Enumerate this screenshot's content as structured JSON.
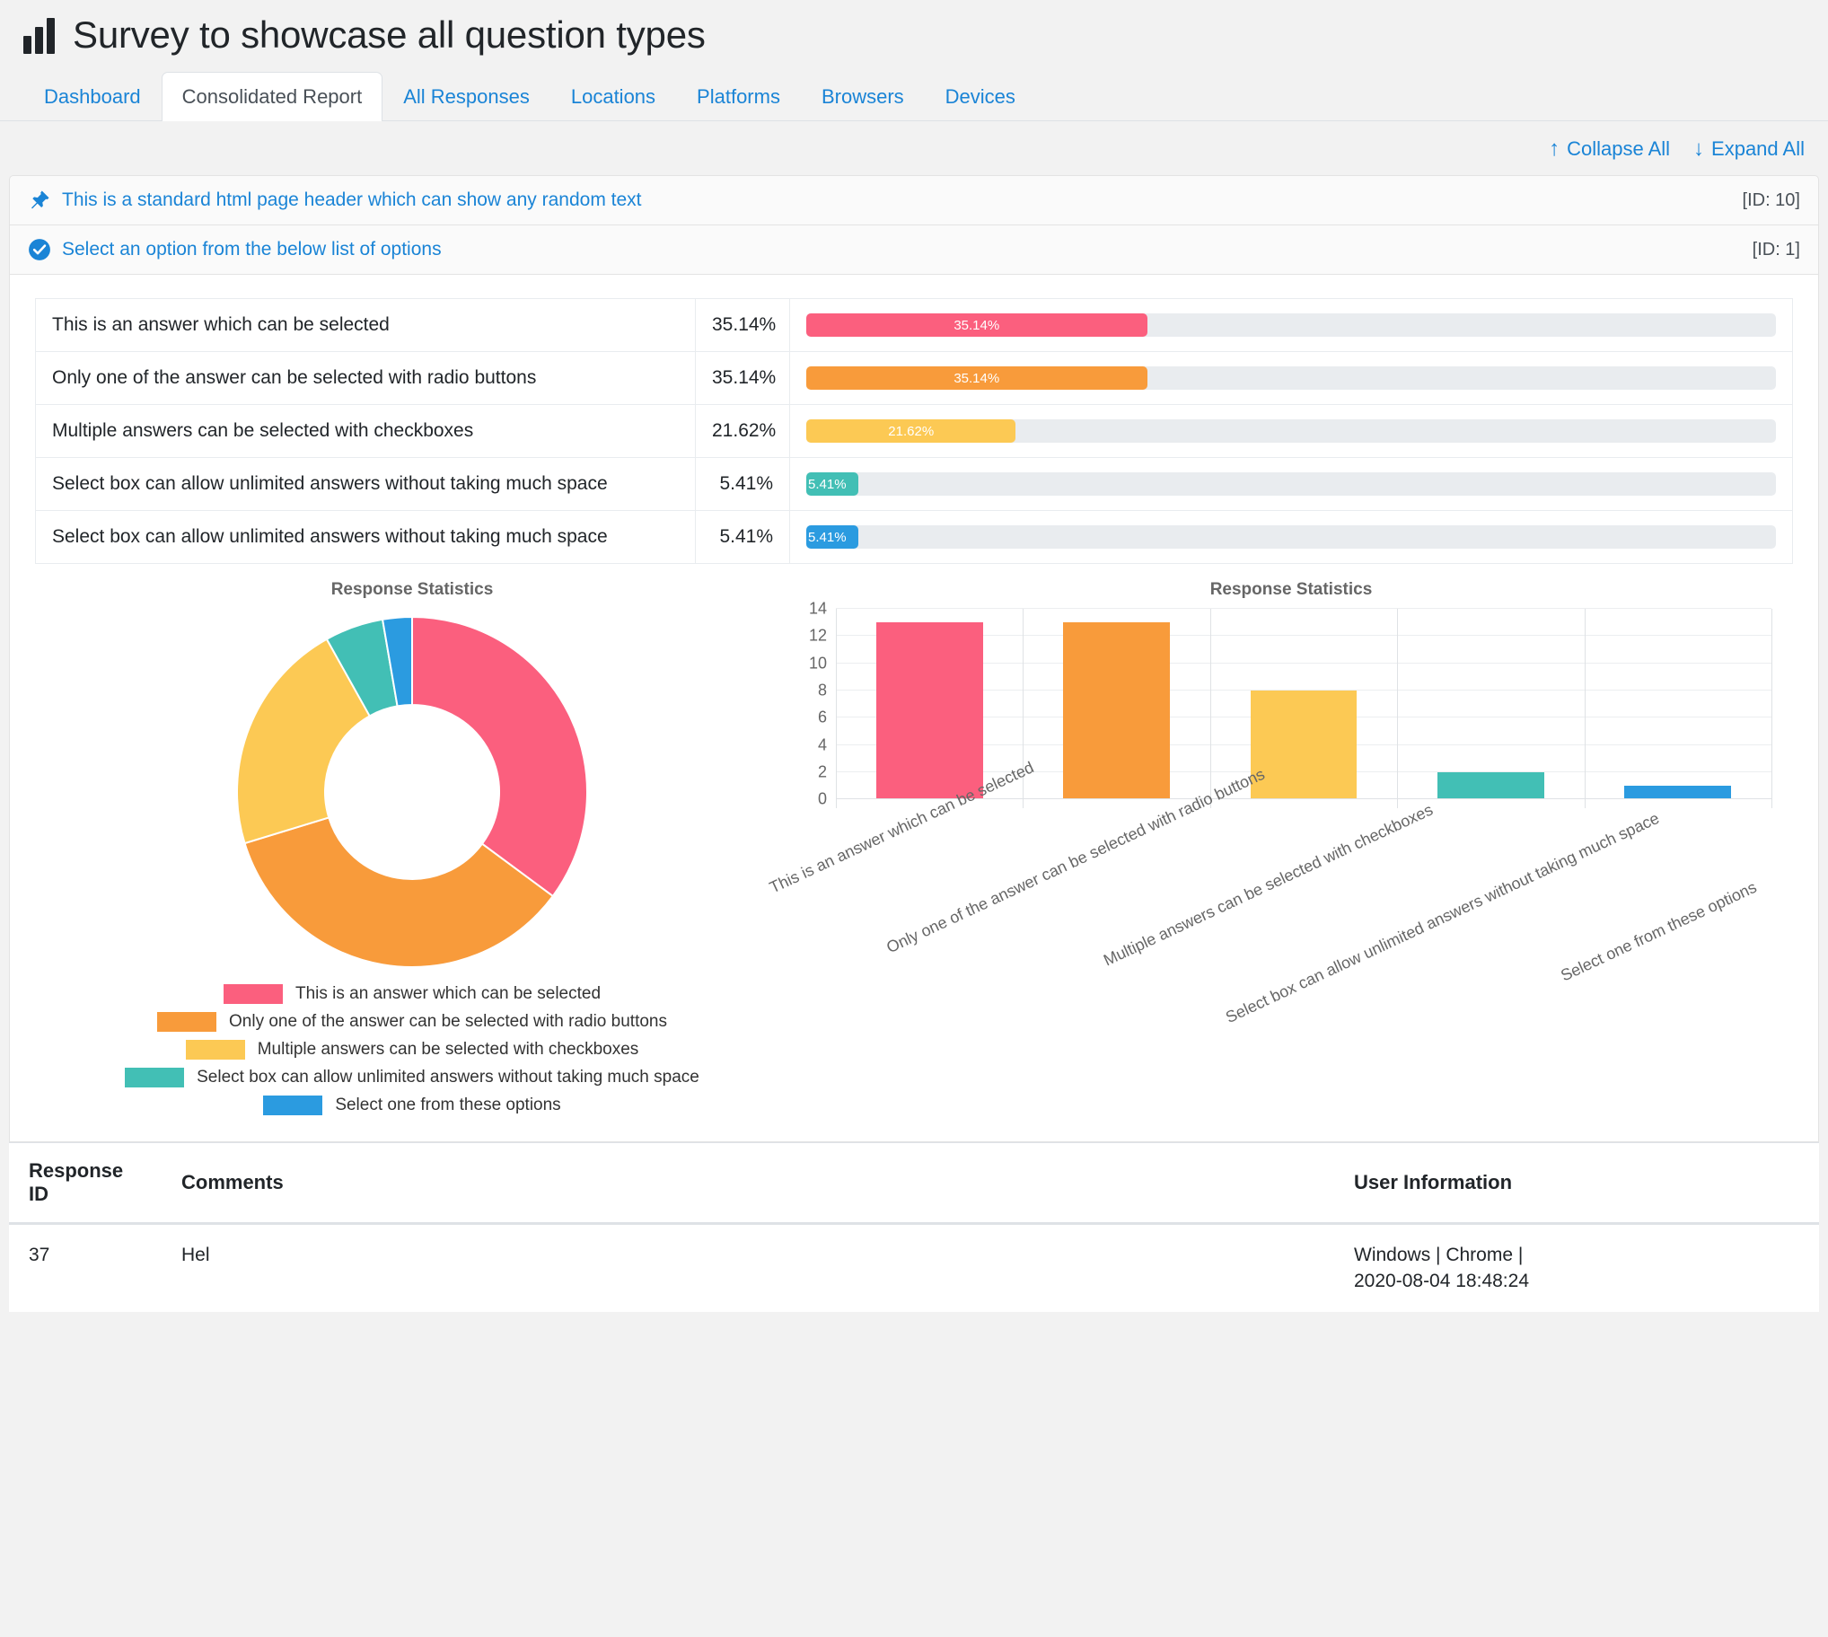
{
  "header": {
    "title": "Survey to showcase all question types",
    "icon": "bar-chart-icon"
  },
  "tabs": [
    {
      "label": "Dashboard",
      "active": false
    },
    {
      "label": "Consolidated Report",
      "active": true
    },
    {
      "label": "All Responses",
      "active": false
    },
    {
      "label": "Locations",
      "active": false
    },
    {
      "label": "Platforms",
      "active": false
    },
    {
      "label": "Browsers",
      "active": false
    },
    {
      "label": "Devices",
      "active": false
    }
  ],
  "tools": {
    "collapse_all": "Collapse All",
    "expand_all": "Expand All",
    "collapse_icon": "arrow-up-icon",
    "expand_icon": "arrow-down-icon"
  },
  "questions": [
    {
      "icon": "pin-icon",
      "text": "This is a standard html page header which can show any random text",
      "id_label": "[ID: 10]"
    },
    {
      "icon": "check-circle-icon",
      "text": "Select an option from the below list of options",
      "id_label": "[ID: 1]"
    }
  ],
  "options_table": {
    "rows": [
      {
        "label": "This is an answer which can be selected",
        "percent": "35.14%",
        "bar_label": "35.14%",
        "value": 35.14,
        "color": "#FB5F7E"
      },
      {
        "label": "Only one of the answer can be selected with radio buttons",
        "percent": "35.14%",
        "bar_label": "35.14%",
        "value": 35.14,
        "color": "#F89B3B"
      },
      {
        "label": "Multiple answers can be selected with checkboxes",
        "percent": "21.62%",
        "bar_label": "21.62%",
        "value": 21.62,
        "color": "#FCC954"
      },
      {
        "label": "Select box can allow unlimited answers without taking much space",
        "percent": "5.41%",
        "bar_label": "5.41%",
        "value": 5.41,
        "color": "#42BFB5"
      },
      {
        "label": "Select box can allow unlimited answers without taking much space",
        "percent": "5.41%",
        "bar_label": "5.41%",
        "value": 5.41,
        "color": "#2B9BE0"
      }
    ]
  },
  "chart_data": [
    {
      "type": "pie",
      "title": "Response Statistics",
      "variant": "donut",
      "labels": [
        "This is an answer which can be selected",
        "Only one of the answer can be selected with radio buttons",
        "Multiple answers can be selected with checkboxes",
        "Select box can allow unlimited answers without taking much space",
        "Select one from these options"
      ],
      "values": [
        13,
        13,
        8,
        2,
        1
      ],
      "percents": [
        35.14,
        35.14,
        21.62,
        5.41,
        2.7
      ],
      "colors": [
        "#FB5F7E",
        "#F89B3B",
        "#FCC954",
        "#42BFB5",
        "#2B9BE0"
      ],
      "legend_position": "bottom"
    },
    {
      "type": "bar",
      "title": "Response Statistics",
      "categories": [
        "This is an answer which can be selected",
        "Only one of the answer can be selected with radio buttons",
        "Multiple answers can be selected with checkboxes",
        "Select box can allow unlimited answers without taking much space",
        "Select one from these options"
      ],
      "values": [
        13,
        13,
        8,
        2,
        1
      ],
      "colors": [
        "#FB5F7E",
        "#F89B3B",
        "#FCC954",
        "#42BFB5",
        "#2B9BE0"
      ],
      "ylim": [
        0,
        14
      ],
      "yticks": [
        0,
        2,
        4,
        6,
        8,
        10,
        12,
        14
      ],
      "xlabel": "",
      "ylabel": "",
      "grid": true,
      "legend_position": "none"
    }
  ],
  "responses_table": {
    "columns": [
      "Response ID",
      "Comments",
      "User Information"
    ],
    "rows": [
      {
        "response_id": "37",
        "comments": "Hel",
        "user_info_line1": "Windows | Chrome |",
        "user_info_line2": "2020-08-04 18:48:24"
      }
    ]
  }
}
